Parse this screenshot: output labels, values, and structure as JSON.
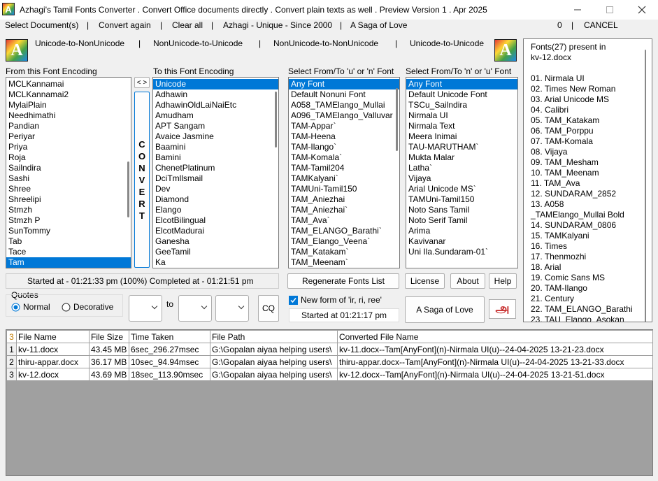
{
  "window": {
    "title": "Azhagi's Tamil Fonts Converter . Convert Office documents directly . Convert plain texts as well . Preview Version 1 . Apr 2025",
    "icon_letter": "A",
    "min_icon": "minimize-icon",
    "max_icon": "maximize-icon",
    "close_icon": "close-icon"
  },
  "menu": {
    "select_docs": "Select Document(s)",
    "sep": "|",
    "convert_again": "Convert again",
    "clear_all": "Clear all",
    "azhagi": "Azhagi - Unique - Since 2000",
    "saga": "A Saga of Love",
    "count": "0",
    "cancel": "CANCEL"
  },
  "modes": {
    "u2nu": "Unicode-to-NonUnicode",
    "nu2u": "NonUnicode-to-Unicode",
    "nu2nu": "NonUnicode-to-NonUnicode",
    "u2u": "Unicode-to-Unicode",
    "sep": "|",
    "logo_letter": "A"
  },
  "from_list": {
    "label": "From this Font Encoding",
    "items": [
      "MCLKannamai",
      "MCLKannamai2",
      "MylaiPlain",
      "Needhimathi",
      "Pandian",
      "Periyar",
      "Priya",
      "Roja",
      "Sailndira",
      "Sashi",
      "Shree",
      "Shreelipi",
      "Stmzh",
      "Stmzh P",
      "SunTommy",
      "Tab",
      "Tace",
      "Tam"
    ],
    "selected_index": 17
  },
  "swap_label": "< >",
  "convert_label": [
    "C",
    "O",
    "N",
    "V",
    "E",
    "R",
    "T"
  ],
  "to_list": {
    "label": "To this Font Encoding",
    "items": [
      "Unicode",
      "Adhawin",
      "AdhawinOldLaiNaiEtc",
      "Amudham",
      "APT Sangam",
      "Avaice Jasmine",
      "Baamini",
      "Bamini",
      "ChenetPlatinum",
      "DciTmllsmail",
      "Dev",
      "Diamond",
      "Elango",
      "ElcotBilingual",
      "ElcotMadurai",
      "Ganesha",
      "GeeTamil",
      "Ka"
    ],
    "selected_index": 0
  },
  "select_u_list": {
    "label": "Select From/To 'u' or 'n'  Font",
    "items": [
      "Any Font",
      "Default Nonuni Font",
      "A058_TAMElango_Mullai",
      "A096_TAMElango_Valluvar",
      "TAM-Appar`",
      "TAM-Heena",
      "TAM-Ilango`",
      "TAM-Komala`",
      "TAM-Tamil204",
      "TAMKalyani`",
      "TAMUni-Tamil150",
      "TAM_Aniezhai",
      "TAM_Aniezhai`",
      "TAM_Ava`",
      "TAM_ELANGO_Barathi`",
      "TAM_Elango_Veena`",
      "TAM_Katakam`",
      "TAM_Meenam`"
    ],
    "selected_index": 0
  },
  "select_n_list": {
    "label": "Select From/To 'n' or 'u' Font",
    "items": [
      "Any Font",
      "Default Unicode Font",
      "TSCu_Sailndira",
      "Nirmala UI",
      "Nirmala Text",
      "Meera Inimai",
      "TAU-MARUTHAM`",
      "Mukta Malar",
      "Latha`",
      "Vijaya",
      "Arial Unicode MS`",
      "TAMUni-Tamil150",
      "Noto Sans Tamil",
      "Noto Serif Tamil",
      "Arima",
      "Kavivanar",
      "Uni Ila.Sundaram-01`"
    ],
    "selected_index": 0
  },
  "fonts_present": {
    "heading": "Fonts(27) present in",
    "file": "kv-12.docx",
    "items": [
      "01. Nirmala UI",
      "02. Times New Roman",
      "03. Arial Unicode MS",
      "04. Calibri",
      "05. TAM_Katakam",
      "06. TAM_Porppu",
      "07. TAM-Komala",
      "08. Vijaya",
      "09. TAM_Mesham",
      "10. TAM_Meenam",
      "11. TAM_Ava",
      "12. SUNDARAM_2852",
      "13. A058",
      "_TAMElango_Mullai Bold",
      "14. SUNDARAM_0806",
      "15. TAMKalyani",
      "16. Times",
      "17. Thenmozhi",
      "18. Arial",
      "19. Comic Sans MS",
      "20. TAM-Ilango",
      "21. Century",
      "22. TAM_ELANGO_Barathi",
      "23. TAU_Elango_Asokan"
    ]
  },
  "status": {
    "progress": "Started at - 01:21:33 pm (100%) Completed at - 01:21:51 pm",
    "started": "Started at 01:21:17 pm"
  },
  "quotes": {
    "label": "Quotes",
    "normal": "Normal",
    "decorative": "Decorative",
    "selected": "Normal"
  },
  "range": {
    "to_label": "to",
    "cq_label": "CQ"
  },
  "buttons": {
    "regenerate": "Regenerate Fonts List",
    "license": "License",
    "about": "About",
    "help": "Help",
    "saga": "A Saga of Love",
    "newform": "New form of  'ir, ri, ree'",
    "newform_checked": true,
    "tamil_logo_glyph": "அ"
  },
  "table": {
    "count": "3",
    "headers": [
      "File Name",
      "File Size",
      "Time Taken",
      "File Path",
      "Converted File Name"
    ],
    "rows": [
      {
        "num": "1",
        "name": "kv-11.docx",
        "size": "43.45 MB",
        "time": "6sec_296.27msec",
        "path": "G:\\Gopalan aiyaa helping users\\",
        "converted": "kv-11.docx--Tam[AnyFont](n)-Nirmala UI(u)--24-04-2025 13-21-23.docx"
      },
      {
        "num": "2",
        "name": "thiru-appar.docx",
        "size": "36.17 MB",
        "time": "10sec_94.94msec",
        "path": "G:\\Gopalan aiyaa helping users\\",
        "converted": "thiru-appar.docx--Tam[AnyFont](n)-Nirmala UI(u)--24-04-2025 13-21-33.docx"
      },
      {
        "num": "3",
        "name": "kv-12.docx",
        "size": "43.69 MB",
        "time": "18sec_113.90msec",
        "path": "G:\\Gopalan aiyaa helping users\\",
        "converted": "kv-12.docx--Tam[AnyFont](n)-Nirmala UI(u)--24-04-2025 13-21-51.docx"
      }
    ]
  }
}
